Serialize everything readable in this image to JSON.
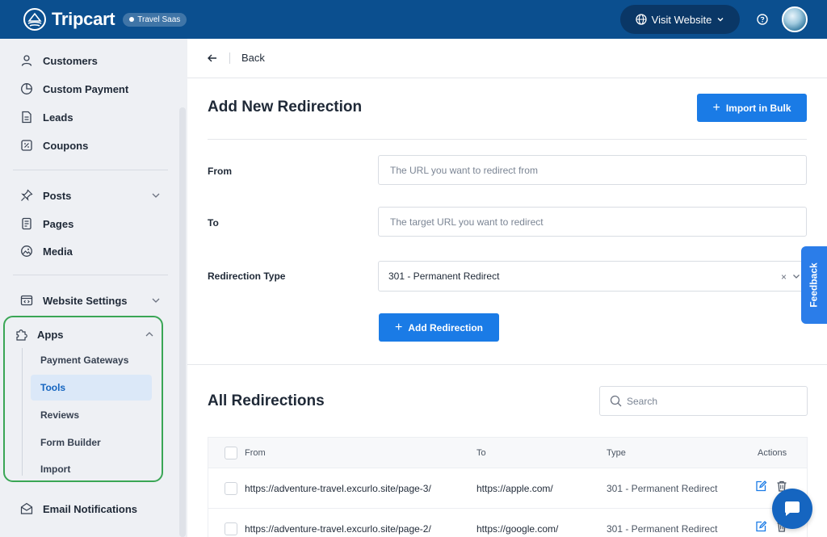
{
  "topbar": {
    "brand": "Tripcart",
    "badge": "Travel Saas",
    "visit_website": "Visit Website"
  },
  "sidebar": {
    "items": [
      {
        "label": "Customers",
        "icon": "user-icon"
      },
      {
        "label": "Custom Payment",
        "icon": "pie-chart-icon"
      },
      {
        "label": "Leads",
        "icon": "document-icon"
      },
      {
        "label": "Coupons",
        "icon": "coupon-icon"
      },
      {
        "label": "Posts",
        "icon": "pin-icon"
      },
      {
        "label": "Pages",
        "icon": "page-icon"
      },
      {
        "label": "Media",
        "icon": "media-icon"
      },
      {
        "label": "Website Settings",
        "icon": "website-settings-icon"
      }
    ],
    "apps": {
      "label": "Apps",
      "children": [
        "Payment Gateways",
        "Tools",
        "Reviews",
        "Form Builder",
        "Import"
      ],
      "active": "Tools"
    },
    "email_notifications": "Email Notifications"
  },
  "main": {
    "back": "Back",
    "title": "Add New Redirection",
    "import_bulk": "Import in Bulk",
    "form": {
      "from_label": "From",
      "from_placeholder": "The URL you want to redirect from",
      "to_label": "To",
      "to_placeholder": "The target URL you want to redirect",
      "type_label": "Redirection Type",
      "type_value": "301 - Permanent Redirect",
      "clear": "×"
    },
    "add_button": "Add Redirection",
    "list_title": "All Redirections",
    "search_placeholder": "Search",
    "table": {
      "headers": {
        "from": "From",
        "to": "To",
        "type": "Type",
        "actions": "Actions"
      },
      "rows": [
        {
          "from": "https://adventure-travel.excurlo.site/page-3/",
          "to": "https://apple.com/",
          "type": "301 - Permanent Redirect"
        },
        {
          "from": "https://adventure-travel.excurlo.site/page-2/",
          "to": "https://google.com/",
          "type": "301 - Permanent Redirect"
        }
      ]
    }
  },
  "feedback": "Feedback",
  "colors": {
    "topbar": "#0b4f8f",
    "primary": "#1a7be6",
    "apps_highlight": "#3aa655",
    "active_item_bg": "#dbe8f8"
  }
}
